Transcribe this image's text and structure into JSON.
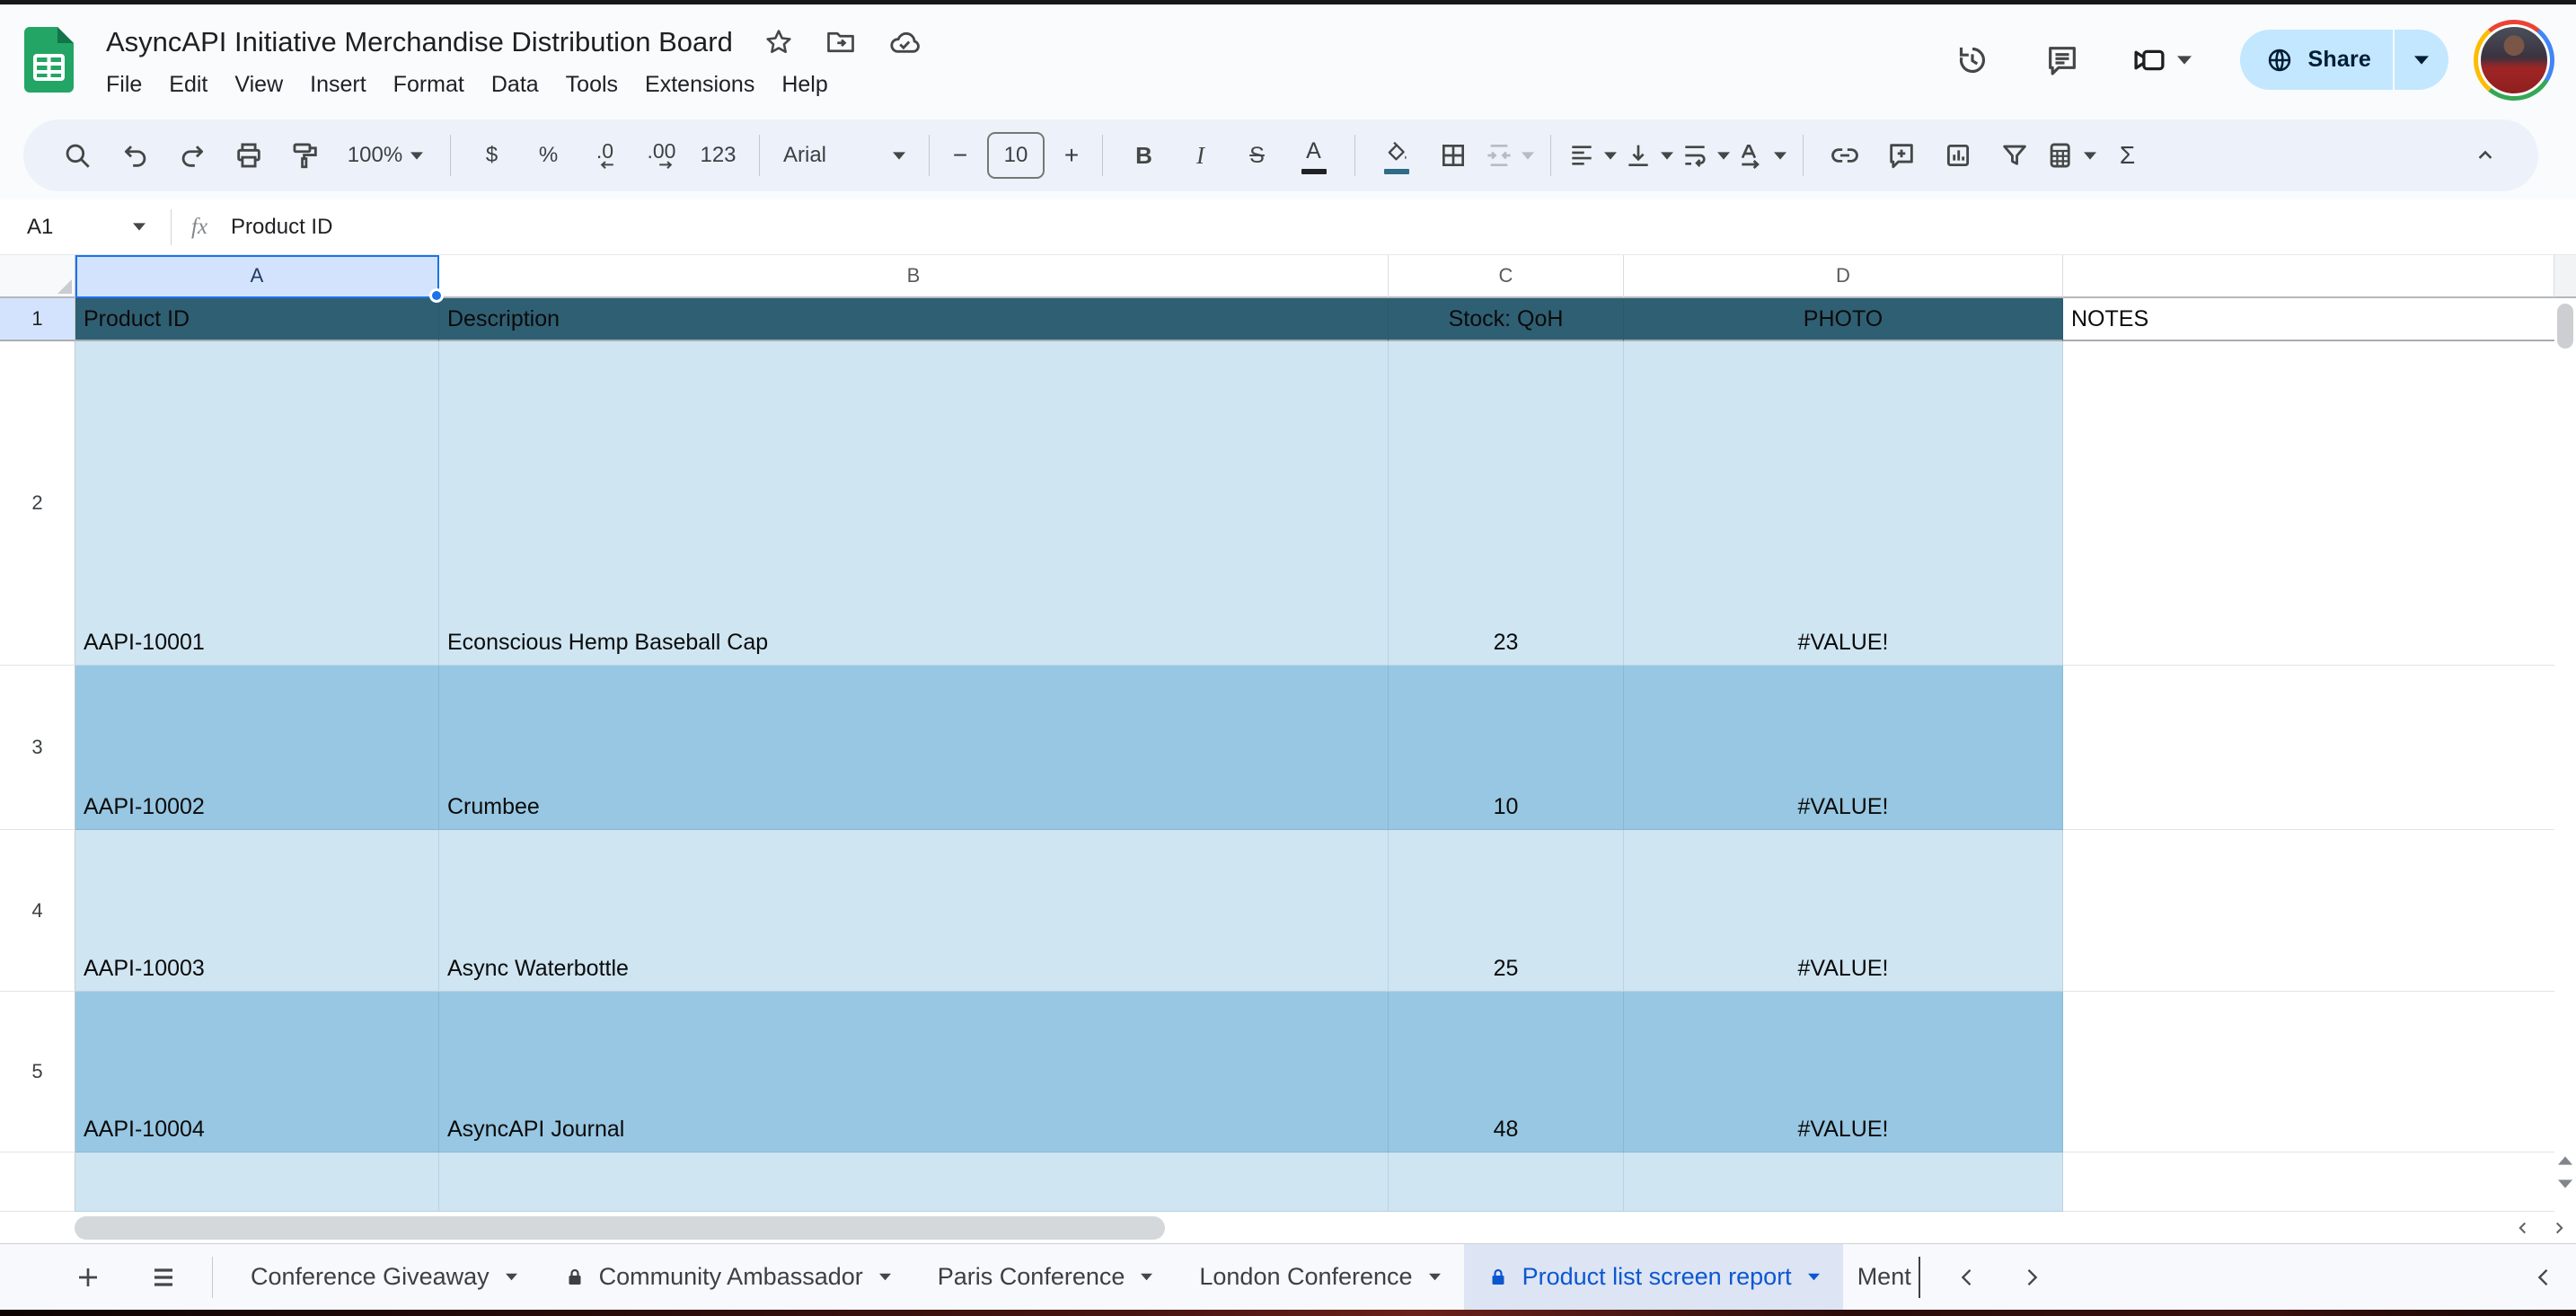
{
  "topbar": {
    "title": "AsyncAPI Initiative Merchandise Distribution Board",
    "menus": [
      "File",
      "Edit",
      "View",
      "Insert",
      "Format",
      "Data",
      "Tools",
      "Extensions",
      "Help"
    ],
    "share_label": "Share"
  },
  "toolbar": {
    "zoom_value": "100%",
    "currency": "$",
    "percent": "%",
    "decimal_decrease": ".0",
    "decimal_increase": ".00",
    "number_format": "123",
    "font_name": "Arial",
    "minus": "−",
    "font_size": "10",
    "plus": "+",
    "bold": "B",
    "italic": "I",
    "strikethrough": "S",
    "text_color": "A",
    "functions": "Σ"
  },
  "formula_bar": {
    "cell_ref": "A1",
    "value": "Product ID"
  },
  "grid": {
    "column_letters": [
      "A",
      "B",
      "C",
      "D",
      ""
    ],
    "header_row": {
      "number": "1",
      "cells": [
        "Product ID",
        "Description",
        "Stock: QoH",
        "PHOTO",
        "NOTES"
      ]
    },
    "rows": [
      {
        "number": "2",
        "cells": [
          "AAPI-10001",
          "Econscious Hemp Baseball Cap",
          "23",
          "#VALUE!",
          ""
        ]
      },
      {
        "number": "3",
        "cells": [
          "AAPI-10002",
          "Crumbee",
          "10",
          "#VALUE!",
          ""
        ]
      },
      {
        "number": "4",
        "cells": [
          "AAPI-10003",
          "Async Waterbottle",
          "25",
          "#VALUE!",
          ""
        ]
      },
      {
        "number": "5",
        "cells": [
          "AAPI-10004",
          "AsyncAPI Journal",
          "48",
          "#VALUE!",
          ""
        ]
      },
      {
        "number": "",
        "cells": [
          "",
          "",
          "",
          "",
          ""
        ]
      }
    ]
  },
  "sheet_tabs": {
    "tabs": [
      {
        "label": "Conference Giveaway",
        "locked": false,
        "active": false
      },
      {
        "label": "Community Ambassador",
        "locked": true,
        "active": false
      },
      {
        "label": "Paris Conference",
        "locked": false,
        "active": false
      },
      {
        "label": "London Conference",
        "locked": false,
        "active": false
      },
      {
        "label": "Product list screen report",
        "locked": true,
        "active": true
      }
    ],
    "partial_tab": "Ment"
  },
  "colors": {
    "header_fill": "#2f5f73",
    "row_light": "#cfe5f2",
    "row_medium": "#97c7e2",
    "selection": "#1a73e8",
    "col_selected": "#d3e3fd",
    "active_tab_bg": "#dde4f4",
    "active_tab_text": "#0b57d0",
    "share_bg": "#c2e7ff",
    "share_text": "#001d35",
    "logo_green": "#23a566"
  }
}
